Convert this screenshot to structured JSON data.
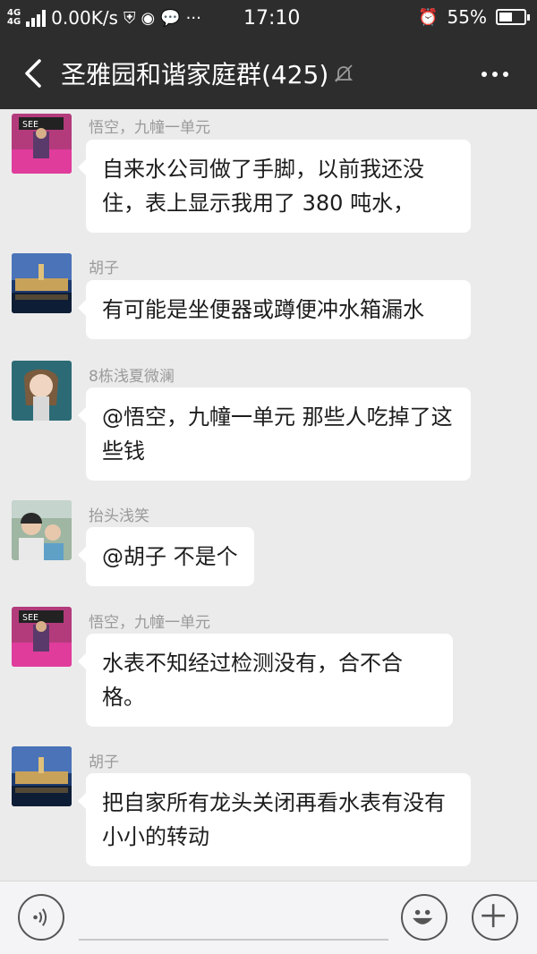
{
  "status": {
    "net_top": "4G",
    "net_bottom": "4G",
    "speed": "0.00K/s",
    "time": "17:10",
    "battery": "55%",
    "battery_level": 0.55
  },
  "header": {
    "title": "圣雅园和谐家庭群(425)"
  },
  "messages": [
    {
      "sender": "悟空，九幢一单元",
      "text": "自来水公司做了手脚，以前我还没住，表上显示我用了 380 吨水，",
      "avatar": "pink-arcade-avatar"
    },
    {
      "sender": "胡子",
      "text": "有可能是坐便器或蹲便冲水箱漏水",
      "avatar": "night-building-avatar"
    },
    {
      "sender": "8栋浅夏微澜",
      "text": "@悟空，九幢一单元  那些人吃掉了这些钱",
      "avatar": "anime-girl-avatar"
    },
    {
      "sender": "抬头浅笑",
      "text": "@胡子  不是个",
      "avatar": "two-people-photo-avatar"
    },
    {
      "sender": "悟空，九幢一单元",
      "text": "水表不知经过检测没有，合不合格。",
      "avatar": "pink-arcade-avatar"
    },
    {
      "sender": "胡子",
      "text": "把自家所有龙头关闭再看水表有没有小小的转动",
      "avatar": "night-building-avatar"
    }
  ]
}
